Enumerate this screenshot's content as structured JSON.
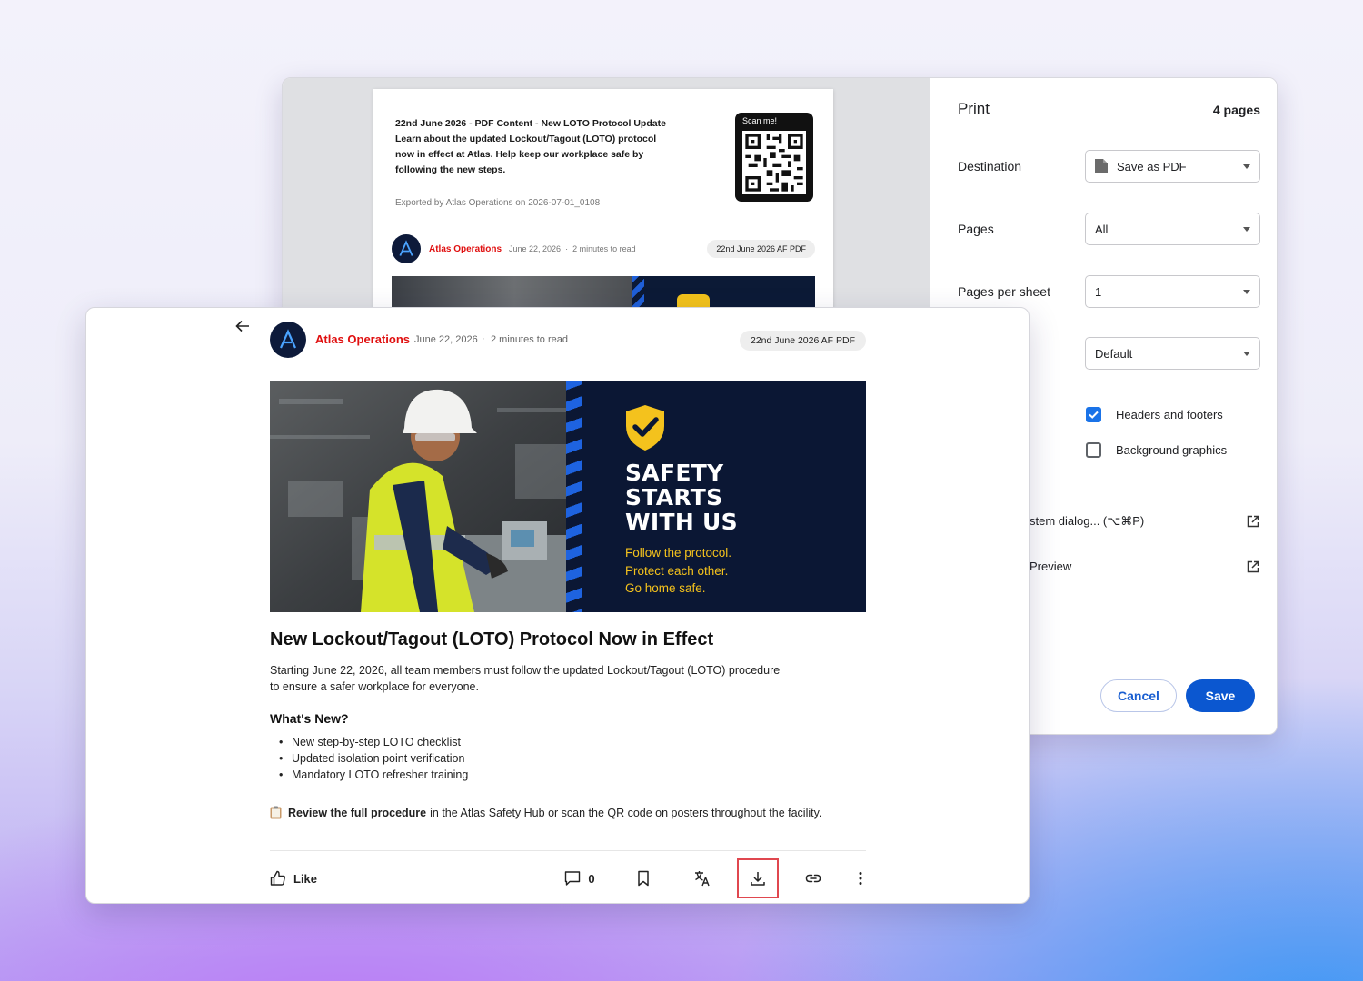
{
  "print_dialog": {
    "title": "Print",
    "page_count": "4 pages",
    "destination": {
      "label": "Destination",
      "value": "Save as PDF"
    },
    "pages": {
      "label": "Pages",
      "value": "All"
    },
    "pages_per_sheet": {
      "label": "Pages per sheet",
      "value": "1"
    },
    "margins": {
      "value": "Default"
    },
    "options": [
      {
        "label": "Headers and footers",
        "checked": true
      },
      {
        "label": "Background graphics",
        "checked": false
      }
    ],
    "links": [
      {
        "label": "stem dialog... (⌥⌘P)"
      },
      {
        "label": "Preview"
      }
    ],
    "cancel_label": "Cancel",
    "save_label": "Save",
    "preview": {
      "header_line1": "22nd June 2026 - PDF Content - New LOTO Protocol Update",
      "header_line2": "Learn about the updated Lockout/Tagout (LOTO) protocol",
      "header_line3": "now in effect at Atlas. Help keep our workplace safe by",
      "header_line4": "following the new steps.",
      "exported": "Exported by Atlas Operations on 2026-07-01_0108",
      "qr_label": "Scan me!",
      "author": "Atlas Operations",
      "date": "June 22, 2026",
      "read_time": "2 minutes to read",
      "pill": "22nd June 2026 AF PDF"
    }
  },
  "post": {
    "author": {
      "name": "Atlas Operations",
      "date": "June 22, 2026",
      "separator": "·",
      "read_time": "2 minutes to read",
      "avatar_letter": "A"
    },
    "pill": "22nd June 2026 AF PDF",
    "banner": {
      "headline": [
        "SAFETY",
        "STARTS",
        "WITH US"
      ],
      "tagline": [
        "Follow the protocol.",
        "Protect each other.",
        "Go home safe."
      ]
    },
    "title": "New Lockout/Tagout (LOTO) Protocol Now in Effect",
    "intro_line1": "Starting June 22, 2026, all team members must follow the updated Lockout/Tagout (LOTO) procedure",
    "intro_line2": "to ensure a safer workplace for everyone.",
    "whats_new_heading": "What's New?",
    "whats_new": [
      "New step-by-step LOTO checklist",
      "Updated isolation point verification",
      "Mandatory LOTO refresher training"
    ],
    "note_bold": "Review the full procedure",
    "note_rest": "in the Atlas Safety Hub or scan the QR code on posters throughout the facility.",
    "actions": {
      "like_label": "Like",
      "comment_count": "0"
    }
  },
  "colors": {
    "brand_red": "#e01010",
    "banner_navy": "#0b1734",
    "banner_yellow": "#f4c21d",
    "print_blue": "#0b57d0",
    "download_highlight": "#e0474f"
  },
  "icons": [
    "back-arrow-icon",
    "document-icon",
    "external-link-icon",
    "like-icon",
    "comment-icon",
    "bookmark-icon",
    "translate-icon",
    "download-icon",
    "link-icon",
    "more-vertical-icon",
    "clipboard-icon",
    "shield-check-icon",
    "qr-code-icon"
  ]
}
